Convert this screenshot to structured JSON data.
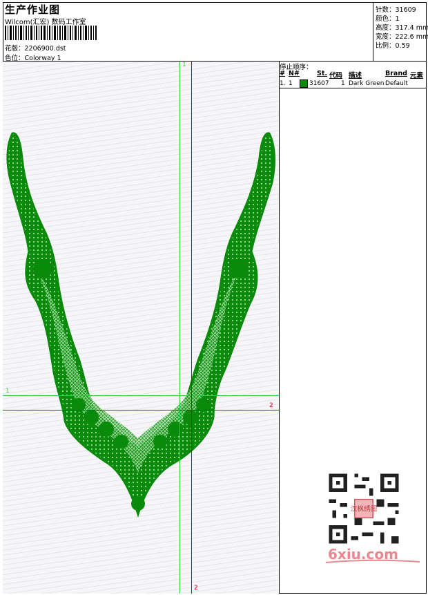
{
  "header": {
    "title": "生产作业图",
    "company": "Wilcom(汇宏) 数码工作室",
    "design_label": "花版：2206900.dst",
    "colorway_label": "色位：Colorway 1"
  },
  "stats": {
    "stitches": "针数：31609",
    "colors": "颜色：1",
    "height": "高度：317.4 mm",
    "width": "宽度：222.6 mm",
    "scale": "比例：0.59"
  },
  "stop_sequence": {
    "title": "停止顺序：",
    "columns": [
      "#",
      "N#",
      "St.",
      "代码",
      "描述",
      "Brand",
      "元素"
    ],
    "rows": [
      {
        "idx": "1.",
        "needle": "1",
        "stitches": "31607",
        "code": "1",
        "description": "Dark Green",
        "brand": "Default",
        "color": "#0a8a0a"
      }
    ]
  },
  "guides": {
    "green_vertical_label": "1",
    "green_horizontal_label": "1",
    "red_horizontal_label": "2",
    "red_vertical_label": "2",
    "green_color": "#2ecc40",
    "red_color": "#cc0000"
  },
  "embroidery": {
    "color": "#0a8a0a",
    "shape": "v-neck-collar-lace"
  },
  "watermark": {
    "text": "6xiu.com",
    "stamp_text": "汉枫绣图",
    "color": "#e8898f"
  }
}
